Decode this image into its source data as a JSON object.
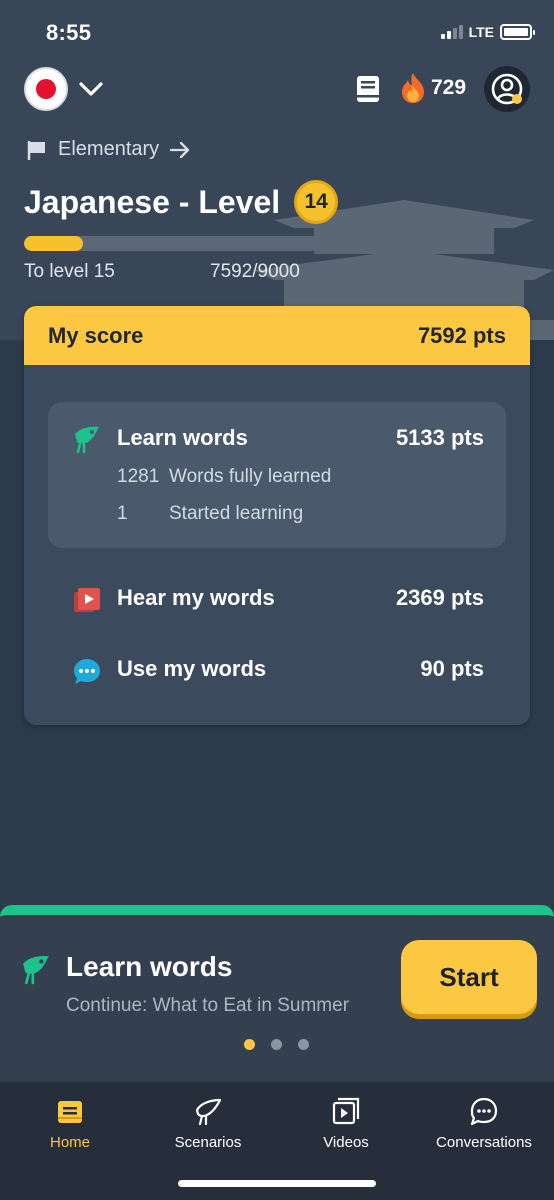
{
  "status_bar": {
    "time": "8:55",
    "network": "LTE"
  },
  "header": {
    "language_flag": "japan-flag",
    "streak_count": "729",
    "icons": [
      "chevron-down-icon",
      "book-icon",
      "fire-icon",
      "profile-icon"
    ]
  },
  "level": {
    "tier": "Elementary",
    "title": "Japanese - Level",
    "level_number": "14",
    "progress_label": "To level 15",
    "progress_count": "7592/9000",
    "progress_fraction": 0.2
  },
  "score": {
    "title": "My score",
    "total": "7592 pts",
    "learn_words": {
      "label": "Learn words",
      "pts": "5133 pts",
      "fully_learned_count": "1281",
      "fully_learned_label": "Words fully learned",
      "started_count": "1",
      "started_label": "Started learning"
    },
    "hear_words": {
      "label": "Hear my words",
      "pts": "2369 pts"
    },
    "use_words": {
      "label": "Use my words",
      "pts": "90 pts"
    }
  },
  "lesson": {
    "title": "Learn words",
    "subtitle": "Continue: What to Eat in Summer",
    "button_label": "Start",
    "page_count": 3,
    "active_page": 1
  },
  "tabs": [
    {
      "label": "Home",
      "icon": "home-icon",
      "active": true
    },
    {
      "label": "Scenarios",
      "icon": "scenarios-icon",
      "active": false
    },
    {
      "label": "Videos",
      "icon": "videos-icon",
      "active": false
    },
    {
      "label": "Conversations",
      "icon": "conversations-icon",
      "active": false
    }
  ],
  "colors": {
    "accent_yellow": "#fcc841",
    "accent_green": "#1ec28b",
    "background": "#2d3a4b",
    "hear_icon_red": "#e0524d",
    "use_icon_blue": "#1fa9d6"
  }
}
